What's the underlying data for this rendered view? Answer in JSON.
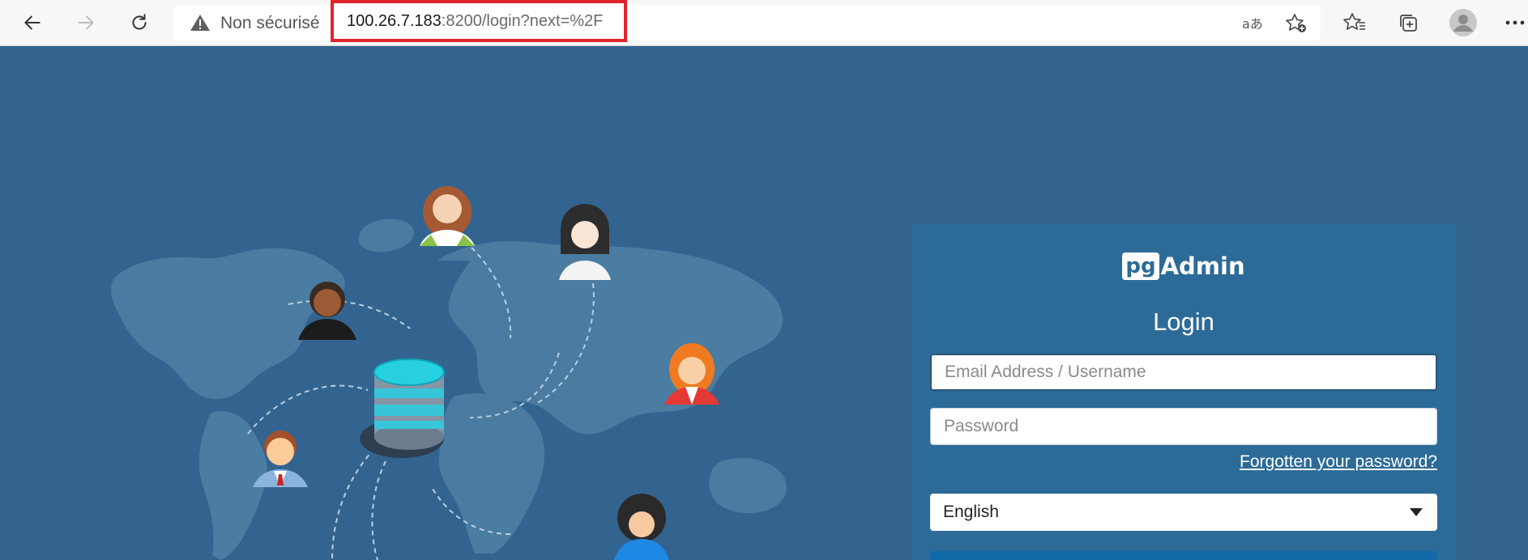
{
  "browser": {
    "security_label": "Non sécurisé",
    "url_host": "100.26.7.183",
    "url_rest": ":8200/login?next=%2F",
    "icons": [
      "back-arrow-icon",
      "forward-arrow-icon",
      "refresh-icon",
      "warning-icon",
      "read-aloud-icon",
      "favorite-add-icon",
      "favorites-icon",
      "collections-icon",
      "profile-icon",
      "more-icon"
    ],
    "highlight_color": "#e0242d"
  },
  "page": {
    "background_color": "#33648f",
    "panel_color": "#2c6b98"
  },
  "login": {
    "logo_box": "pg",
    "logo_text": "Admin",
    "title": "Login",
    "email_placeholder": "Email Address / Username",
    "password_placeholder": "Password",
    "forgot_label": "Forgotten your password?",
    "language": "English"
  }
}
